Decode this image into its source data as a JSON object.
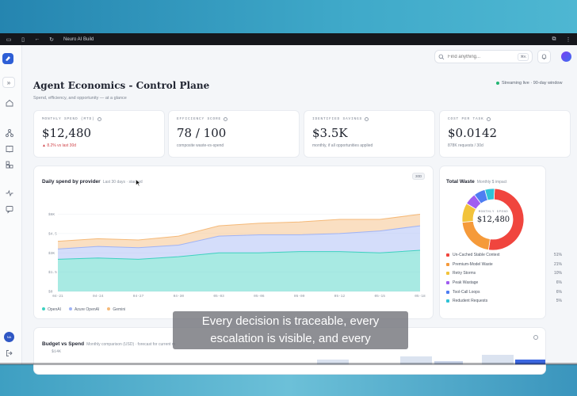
{
  "window": {
    "app_title": "Neuro AI Build"
  },
  "search": {
    "placeholder": "Find anything...",
    "shortcut": "⌘K"
  },
  "sidebar": {
    "user_initials": "NA"
  },
  "page": {
    "title": "Agent Economics - Control Plane",
    "subtitle": "Spend, efficiency, and opportunity — at a glance",
    "status": "Streaming live · 90-day window"
  },
  "kpis": [
    {
      "label": "MONTHLY SPEND (MTD)",
      "value": "$12,480",
      "note": "▲ 8.2% vs last 30d",
      "note_tone": "negative"
    },
    {
      "label": "EFFICIENCY SCORE",
      "value": "78 / 100",
      "note": "composite waste-vs-spend",
      "note_tone": "neutral"
    },
    {
      "label": "IDENTIFIED SAVINGS",
      "value": "$3.5K",
      "note": "monthly, if all opportunities applied",
      "note_tone": "neutral"
    },
    {
      "label": "COST PER TASK",
      "value": "$0.0142",
      "note": "878K requests / 30d",
      "note_tone": "neutral"
    }
  ],
  "daily_spend": {
    "title": "Daily spend by provider",
    "subtitle": "Last 30 days · stacked",
    "range_button": "30D"
  },
  "total_waste": {
    "title": "Total Waste",
    "subtitle": "Monthly $ impact",
    "center_label": "MONTHLY SPEND",
    "center_value": "$12,480",
    "items": [
      {
        "label": "Un-Cached Stable Context",
        "pct": "51%",
        "color": "#f0453e"
      },
      {
        "label": "Premium-Model Waste",
        "pct": "21%",
        "color": "#f59a3a"
      },
      {
        "label": "Retry Storms",
        "pct": "10%",
        "color": "#f2c33a"
      },
      {
        "label": "Peak Wastage",
        "pct": "6%",
        "color": "#a05df0"
      },
      {
        "label": "Tool-Call Loops",
        "pct": "6%",
        "color": "#4e7df2"
      },
      {
        "label": "Redudent Requests",
        "pct": "5%",
        "color": "#2fc2d6"
      }
    ]
  },
  "budget": {
    "title": "Budget vs Spend",
    "subtitle": "Monthly comparison (USD) · forecast for current m",
    "y_top": "$14K"
  },
  "caption": {
    "line1": "Every decision is traceable, every",
    "line2": "escalation is visible, and every"
  },
  "chart_data": [
    {
      "type": "area",
      "title": "Daily spend by provider",
      "stacked": true,
      "x": [
        "04-21",
        "04-24",
        "04-27",
        "04-30",
        "05-03",
        "05-06",
        "05-09",
        "05-12",
        "05-15",
        "05-18"
      ],
      "ylabel": "",
      "ylim": [
        0,
        8
      ],
      "yticks": [
        "$0",
        "$1.5",
        "$3K",
        "$4.5",
        "$6K"
      ],
      "yticks_values": [
        0,
        1.5,
        3,
        4.5,
        6
      ],
      "series": [
        {
          "name": "OpenAI",
          "color": "#3ed1c0",
          "values": [
            2.5,
            2.6,
            2.5,
            2.7,
            3.0,
            3.0,
            3.1,
            3.1,
            3.0,
            3.2
          ]
        },
        {
          "name": "Azure OpenAI",
          "color": "#9fb3f5",
          "values": [
            0.8,
            0.9,
            0.9,
            0.9,
            1.3,
            1.4,
            1.3,
            1.4,
            1.7,
            1.9
          ]
        },
        {
          "name": "Gemini",
          "color": "#f5b978",
          "values": [
            0.6,
            0.6,
            0.6,
            0.7,
            0.8,
            0.9,
            1.0,
            1.1,
            0.9,
            0.9
          ]
        }
      ],
      "legend": "bottom-left",
      "grid": true
    },
    {
      "type": "pie",
      "title": "Total Waste",
      "categories": [
        "Un-Cached Stable Context",
        "Premium-Model Waste",
        "Retry Storms",
        "Peak Wastage",
        "Tool-Call Loops",
        "Redudent Requests"
      ],
      "values": [
        51,
        21,
        10,
        6,
        6,
        5
      ],
      "donut": true
    }
  ]
}
